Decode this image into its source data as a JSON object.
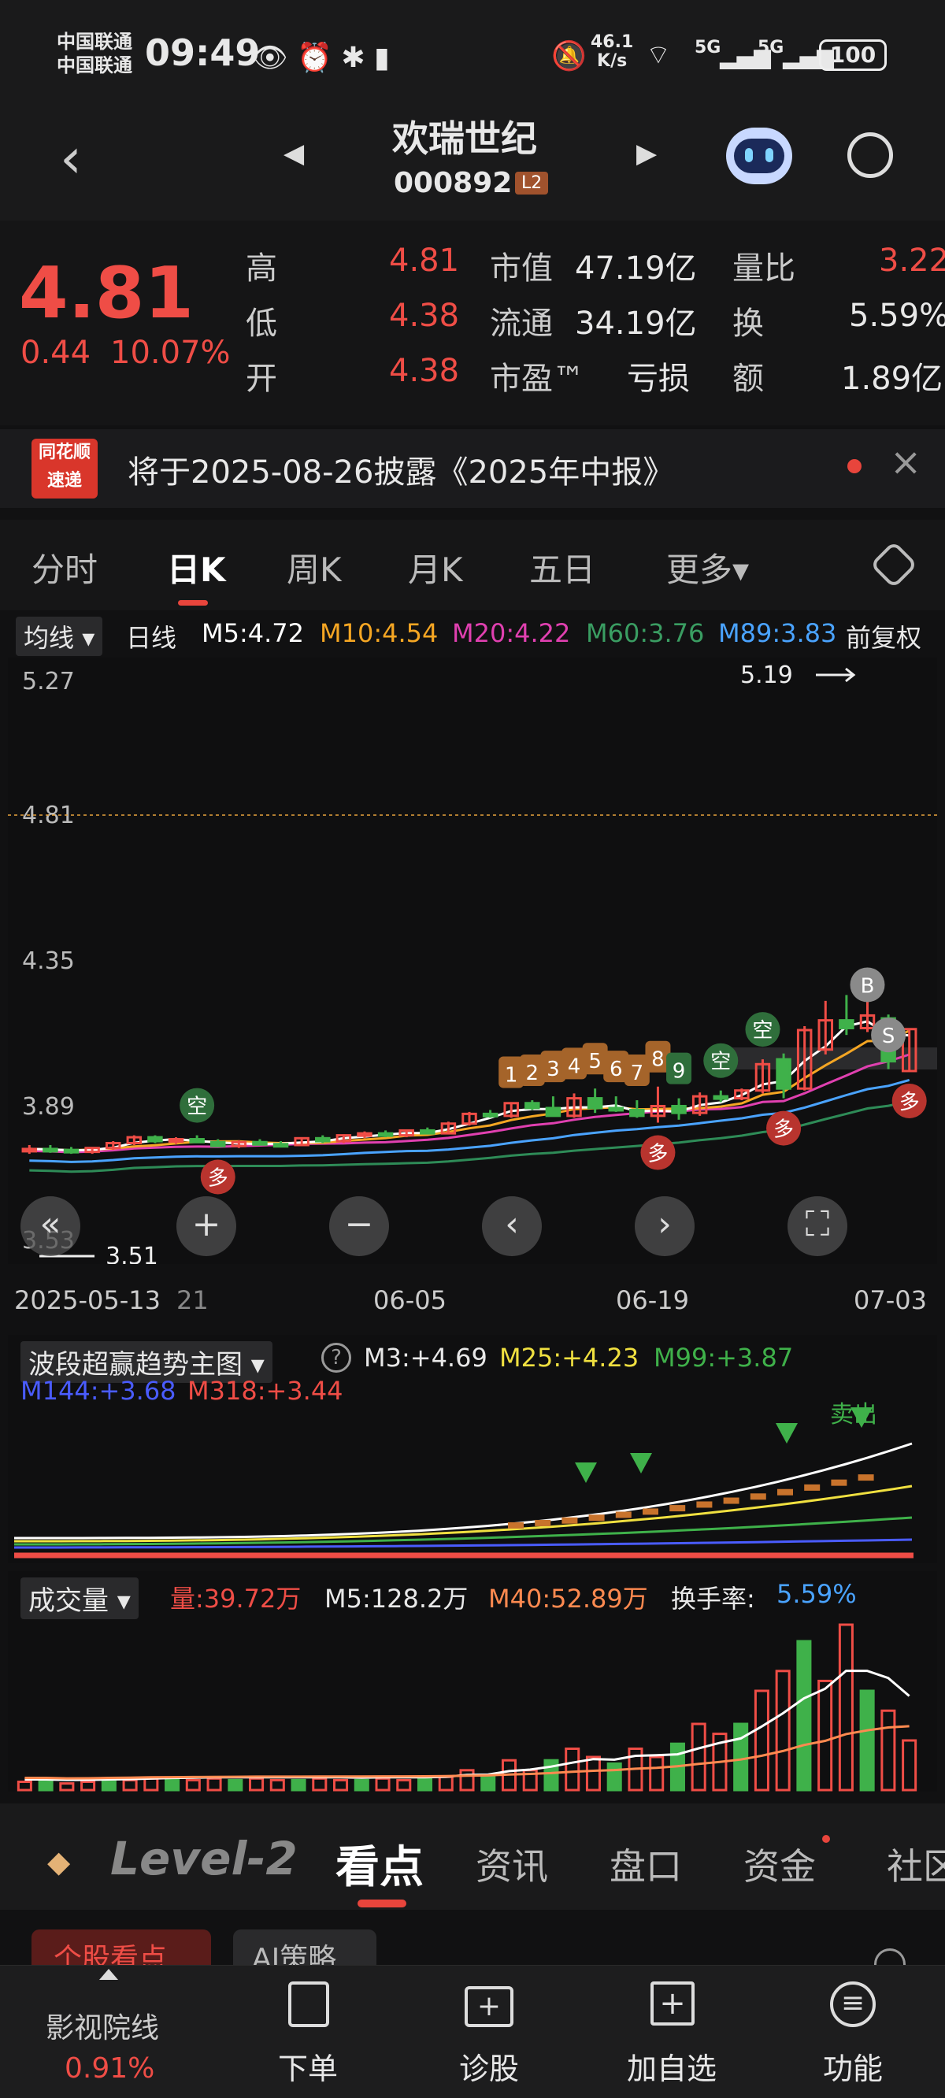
{
  "status_bar": {
    "carrier1": "中国联通",
    "carrier2": "中国联通",
    "time": "09:49",
    "speed_top": "46.1",
    "speed_unit": "K/s",
    "battery": "100",
    "net1": "5G",
    "net2": "5G"
  },
  "header": {
    "name": "欢瑞世纪",
    "code": "000892",
    "badge": "L2"
  },
  "quote": {
    "price": "4.81",
    "change": "0.44",
    "change_pct": "10.07%",
    "high_label": "高",
    "high": "4.81",
    "low_label": "低",
    "low": "4.38",
    "open_label": "开",
    "open": "4.38",
    "mcap_label": "市值",
    "mcap": "47.19亿",
    "float_label": "流通",
    "float": "34.19亿",
    "pe_label": "市盈™",
    "pe": "亏损",
    "vr_label": "量比",
    "vr": "3.22",
    "turn_label": "换",
    "turn": "5.59%",
    "amt_label": "额",
    "amt": "1.89亿"
  },
  "notice": {
    "logo_top": "同花顺",
    "logo_bottom": "速递",
    "text": "将于2025-08-26披露《2025年中报》",
    "close": "×"
  },
  "tabs": [
    {
      "label": "分时"
    },
    {
      "label": "日K"
    },
    {
      "label": "周K"
    },
    {
      "label": "月K"
    },
    {
      "label": "五日"
    },
    {
      "label": "更多▾"
    }
  ],
  "legend": {
    "ma_btn": "均线",
    "period": "日线",
    "m5": "M5:4.72",
    "m10": "M10:4.54",
    "m20": "M20:4.22",
    "m60": "M60:3.76",
    "m89": "M89:3.83",
    "adj": "前复权"
  },
  "colors": {
    "up": "#ef4d46",
    "down": "#3fb14a",
    "m5": "#ffffff",
    "m10": "#f5a623",
    "m20": "#e040b0",
    "m60": "#2e8b57",
    "m89": "#4aa3ff"
  },
  "chart_data": {
    "type": "candlestick",
    "y_axis_ticks": [
      "5.27",
      "4.81",
      "4.35",
      "3.89",
      "3.53"
    ],
    "x_axis_labels": [
      "2025-05-13",
      "21",
      "06-05",
      "06-19",
      "07-03"
    ],
    "high_marker": "5.19",
    "low_marker": "3.51",
    "candles": [
      {
        "o": 3.56,
        "h": 3.62,
        "l": 3.53,
        "c": 3.58
      },
      {
        "o": 3.58,
        "h": 3.62,
        "l": 3.54,
        "c": 3.57
      },
      {
        "o": 3.57,
        "h": 3.6,
        "l": 3.53,
        "c": 3.55
      },
      {
        "o": 3.55,
        "h": 3.6,
        "l": 3.53,
        "c": 3.59
      },
      {
        "o": 3.59,
        "h": 3.66,
        "l": 3.57,
        "c": 3.64
      },
      {
        "o": 3.64,
        "h": 3.72,
        "l": 3.62,
        "c": 3.7
      },
      {
        "o": 3.7,
        "h": 3.72,
        "l": 3.64,
        "c": 3.66
      },
      {
        "o": 3.66,
        "h": 3.7,
        "l": 3.63,
        "c": 3.68
      },
      {
        "o": 3.68,
        "h": 3.72,
        "l": 3.64,
        "c": 3.65
      },
      {
        "o": 3.65,
        "h": 3.68,
        "l": 3.6,
        "c": 3.61
      },
      {
        "o": 3.61,
        "h": 3.67,
        "l": 3.59,
        "c": 3.65
      },
      {
        "o": 3.65,
        "h": 3.68,
        "l": 3.62,
        "c": 3.63
      },
      {
        "o": 3.63,
        "h": 3.66,
        "l": 3.6,
        "c": 3.62
      },
      {
        "o": 3.62,
        "h": 3.7,
        "l": 3.61,
        "c": 3.69
      },
      {
        "o": 3.69,
        "h": 3.72,
        "l": 3.64,
        "c": 3.66
      },
      {
        "o": 3.66,
        "h": 3.73,
        "l": 3.64,
        "c": 3.72
      },
      {
        "o": 3.72,
        "h": 3.76,
        "l": 3.69,
        "c": 3.74
      },
      {
        "o": 3.74,
        "h": 3.77,
        "l": 3.7,
        "c": 3.72
      },
      {
        "o": 3.72,
        "h": 3.78,
        "l": 3.7,
        "c": 3.77
      },
      {
        "o": 3.77,
        "h": 3.8,
        "l": 3.73,
        "c": 3.74
      },
      {
        "o": 3.74,
        "h": 3.86,
        "l": 3.73,
        "c": 3.84
      },
      {
        "o": 3.84,
        "h": 3.96,
        "l": 3.82,
        "c": 3.94
      },
      {
        "o": 3.94,
        "h": 3.98,
        "l": 3.9,
        "c": 3.92
      },
      {
        "o": 3.92,
        "h": 4.06,
        "l": 3.9,
        "c": 4.05
      },
      {
        "o": 4.05,
        "h": 4.08,
        "l": 3.98,
        "c": 4.0
      },
      {
        "o": 4.0,
        "h": 4.12,
        "l": 3.98,
        "c": 3.92
      },
      {
        "o": 3.92,
        "h": 4.15,
        "l": 3.9,
        "c": 4.1
      },
      {
        "o": 4.1,
        "h": 4.2,
        "l": 3.95,
        "c": 4.0
      },
      {
        "o": 4.0,
        "h": 4.12,
        "l": 3.96,
        "c": 3.98
      },
      {
        "o": 3.98,
        "h": 4.08,
        "l": 3.9,
        "c": 3.92
      },
      {
        "o": 3.92,
        "h": 4.22,
        "l": 3.85,
        "c": 4.02
      },
      {
        "o": 4.02,
        "h": 4.1,
        "l": 3.88,
        "c": 3.95
      },
      {
        "o": 3.95,
        "h": 4.16,
        "l": 3.92,
        "c": 4.12
      },
      {
        "o": 4.12,
        "h": 4.18,
        "l": 4.06,
        "c": 4.1
      },
      {
        "o": 4.1,
        "h": 4.2,
        "l": 4.08,
        "c": 4.18
      },
      {
        "o": 4.18,
        "h": 4.5,
        "l": 4.15,
        "c": 4.45
      },
      {
        "o": 4.5,
        "h": 4.56,
        "l": 4.1,
        "c": 4.2
      },
      {
        "o": 4.2,
        "h": 4.84,
        "l": 4.18,
        "c": 4.8
      },
      {
        "o": 4.6,
        "h": 5.1,
        "l": 4.55,
        "c": 4.9
      },
      {
        "o": 4.9,
        "h": 5.16,
        "l": 4.75,
        "c": 4.82
      },
      {
        "o": 4.82,
        "h": 5.19,
        "l": 4.78,
        "c": 4.95
      },
      {
        "o": 4.92,
        "h": 4.96,
        "l": 4.4,
        "c": 4.48
      },
      {
        "o": 4.38,
        "h": 4.81,
        "l": 4.38,
        "c": 4.81
      }
    ],
    "bubbles": [
      {
        "i": 23,
        "t": "1"
      },
      {
        "i": 24,
        "t": "2"
      },
      {
        "i": 25,
        "t": "3"
      },
      {
        "i": 26,
        "t": "4"
      },
      {
        "i": 27,
        "t": "5"
      },
      {
        "i": 28,
        "t": "6"
      },
      {
        "i": 29,
        "t": "7"
      },
      {
        "i": 30,
        "t": "8"
      },
      {
        "i": 31,
        "t": "9"
      }
    ],
    "tags": [
      {
        "i": 8,
        "t": "空"
      },
      {
        "i": 33,
        "t": "空"
      },
      {
        "i": 35,
        "t": "空"
      },
      {
        "i": 30,
        "t": "多"
      },
      {
        "i": 36,
        "t": "多"
      },
      {
        "i": 9,
        "t": "多"
      },
      {
        "i": 42,
        "t": "多"
      },
      {
        "i": 41,
        "t": "S"
      },
      {
        "i": 40,
        "t": "B"
      }
    ]
  },
  "ind1": {
    "name": "波段超赢趋势主图",
    "m3": "M3:+4.69",
    "m25": "M25:+4.23",
    "m99": "M99:+3.87",
    "m144": "M144:+3.68",
    "m318": "M318:+3.44",
    "sell": "卖出"
  },
  "ind2": {
    "name": "成交量",
    "vol": "量:39.72万",
    "m5": "M5:128.2万",
    "m40": "M40:52.89万",
    "turn": "换手率:",
    "turn_val": "5.59%",
    "volumes": [
      0.05,
      0.05,
      0.04,
      0.05,
      0.06,
      0.06,
      0.07,
      0.06,
      0.06,
      0.07,
      0.06,
      0.07,
      0.06,
      0.06,
      0.07,
      0.06,
      0.06,
      0.07,
      0.06,
      0.07,
      0.08,
      0.12,
      0.08,
      0.18,
      0.12,
      0.18,
      0.25,
      0.2,
      0.16,
      0.25,
      0.2,
      0.28,
      0.4,
      0.34,
      0.4,
      0.6,
      0.72,
      0.9,
      0.66,
      1.0,
      0.6,
      0.48,
      0.3
    ]
  },
  "level": {
    "brand": "Level-2",
    "tabs": [
      "看点",
      "资讯",
      "盘口",
      "资金",
      "社区"
    ],
    "sub1": "个股看点",
    "sub2": "AI策略"
  },
  "bottom": {
    "sector": "影视院线",
    "sector_pct": "0.91%",
    "order": "下单",
    "diag": "诊股",
    "add": "加自选",
    "func": "功能"
  }
}
